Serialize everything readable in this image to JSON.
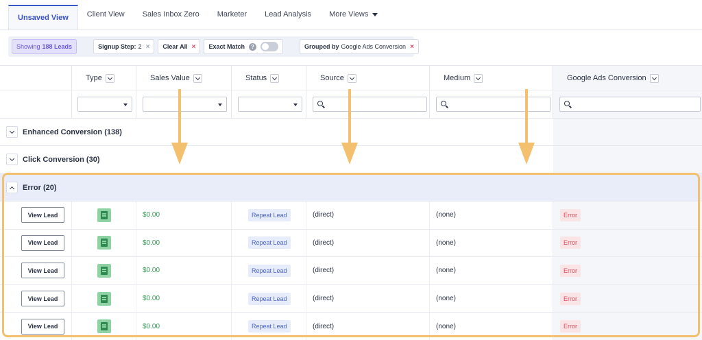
{
  "tabs": [
    {
      "label": "Unsaved View",
      "active": true
    },
    {
      "label": "Client View"
    },
    {
      "label": "Sales Inbox Zero"
    },
    {
      "label": "Marketer"
    },
    {
      "label": "Lead Analysis"
    },
    {
      "label": "More Views"
    }
  ],
  "filters": {
    "showing_prefix": "Showing",
    "showing_count": "188 Leads",
    "signup_label": "Signup Step:",
    "signup_value": "2",
    "clear_all": "Clear All",
    "exact_match": "Exact Match",
    "help_glyph": "?",
    "grouped_label": "Grouped by",
    "grouped_value": "Google Ads Conversion",
    "remove_glyph": "×"
  },
  "columns": [
    "Type",
    "Sales Value",
    "Status",
    "Source",
    "Medium",
    "Google Ads Conversion"
  ],
  "groups": [
    {
      "label": "Enhanced Conversion (138)",
      "expanded": false
    },
    {
      "label": "Click Conversion (30)",
      "expanded": false
    },
    {
      "label": "Error (20)",
      "expanded": true
    }
  ],
  "rows": [
    {
      "action": "View Lead",
      "value": "$0.00",
      "status": "Repeat Lead",
      "source": "(direct)",
      "medium": "(none)",
      "gac": "Error"
    },
    {
      "action": "View Lead",
      "value": "$0.00",
      "status": "Repeat Lead",
      "source": "(direct)",
      "medium": "(none)",
      "gac": "Error"
    },
    {
      "action": "View Lead",
      "value": "$0.00",
      "status": "Repeat Lead",
      "source": "(direct)",
      "medium": "(none)",
      "gac": "Error"
    },
    {
      "action": "View Lead",
      "value": "$0.00",
      "status": "Repeat Lead",
      "source": "(direct)",
      "medium": "(none)",
      "gac": "Error"
    },
    {
      "action": "View Lead",
      "value": "$0.00",
      "status": "Repeat Lead",
      "source": "(direct)",
      "medium": "(none)",
      "gac": "Error"
    }
  ],
  "icons": {
    "type_icon": "form-icon",
    "search_icon": "search-icon"
  },
  "colors": {
    "accent": "#3b55c9",
    "highlight": "#f2c06e",
    "money": "#2f9a53",
    "error": "#d84a5a"
  }
}
